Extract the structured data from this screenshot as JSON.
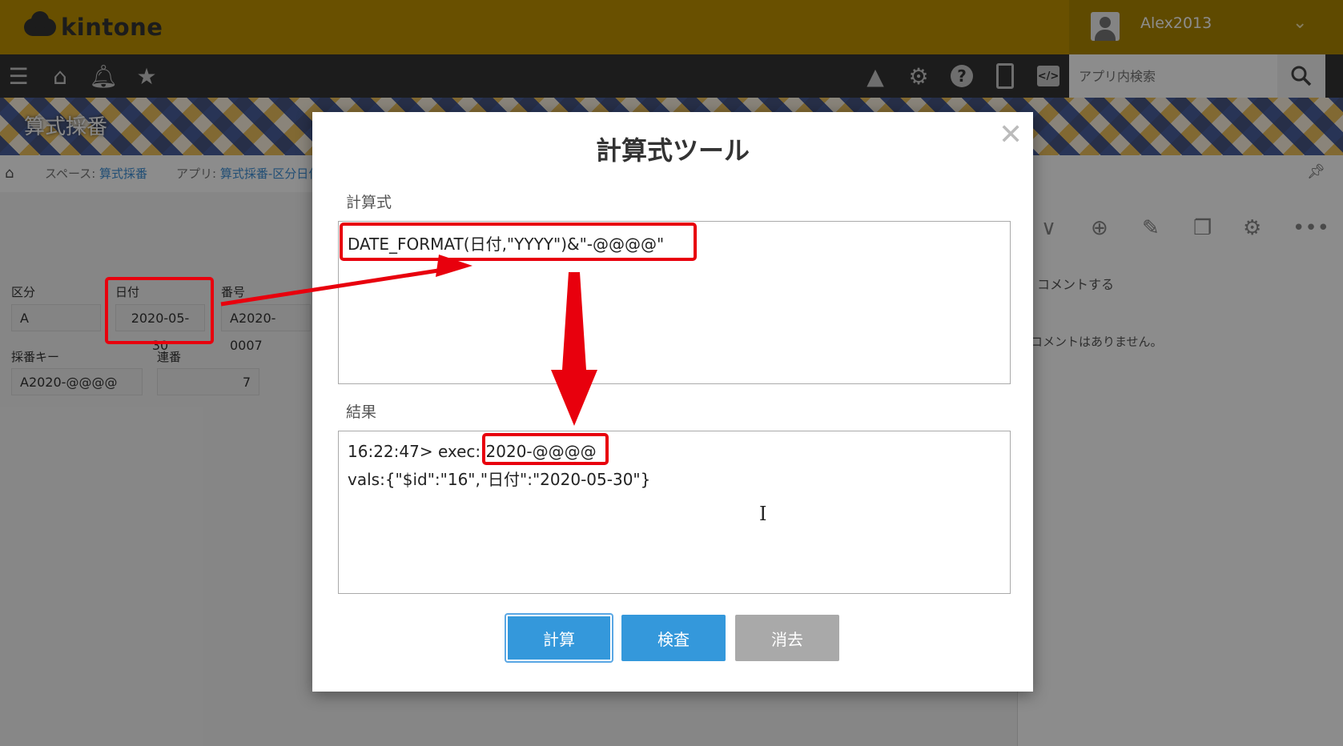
{
  "header": {
    "logo_text": "kintone",
    "username": "Alex2013",
    "search_placeholder": "アプリ内検索"
  },
  "nav_icons": [
    "menu-icon",
    "home-icon",
    "bell-icon",
    "star-icon",
    "warning-icon",
    "gear-icon",
    "help-icon",
    "mobile-icon",
    "code-icon",
    "search-icon"
  ],
  "banner": {
    "title": "算式採番"
  },
  "breadcrumb": {
    "space_prefix": "スペース:",
    "space_name": "算式採番",
    "app_prefix": "アプリ:",
    "app_name": "算式採番-区分日付"
  },
  "record": {
    "fields": [
      {
        "label": "区分",
        "value": "A"
      },
      {
        "label": "日付",
        "value": "2020-05-30"
      },
      {
        "label": "番号",
        "value": "A2020-0007"
      },
      {
        "label": "採番キー",
        "value": "A2020-@@@@"
      },
      {
        "label": "連番",
        "value": "7"
      }
    ]
  },
  "side_panel": {
    "comment_link": "コメントする",
    "no_comment": "コメントはありません。"
  },
  "modal": {
    "title": "計算式ツール",
    "formula_label": "計算式",
    "formula": "DATE_FORMAT(日付,\"YYYY\")&\"-@@@@\"",
    "result_label": "結果",
    "result_prefix": "16:22:47> exec: ",
    "result_value": "2020-@@@@",
    "result_vals": "vals:{\"$id\":\"16\",\"日付\":\"2020-05-30\"}",
    "buttons": {
      "calc": "計算",
      "check": "検査",
      "clear": "消去"
    }
  },
  "colors": {
    "header": "#bf9300",
    "nav": "#333333",
    "button_blue": "#3498db",
    "button_gray": "#a9a9a9",
    "annotation_red": "#e8000d"
  }
}
